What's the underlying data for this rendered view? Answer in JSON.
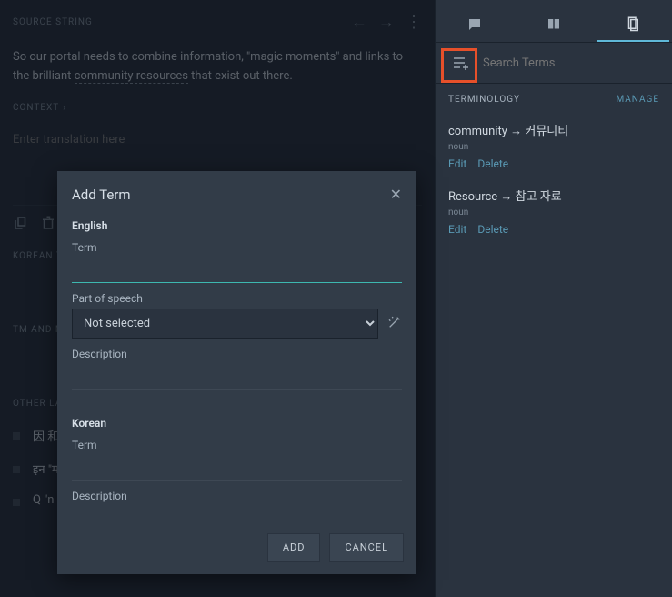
{
  "source": {
    "label": "SOURCE STRING",
    "text_before": "So our portal needs to combine information, \"magic moments\" and links to the brilliant ",
    "underlined": "community resources",
    "text_after": " that exist out there."
  },
  "context": {
    "label": "CONTEXT"
  },
  "translation": {
    "placeholder": "Enter translation here"
  },
  "sections": {
    "korean": "KOREAN T",
    "tm": "TM AND M",
    "other": "OTHER LA"
  },
  "other_items": [
    "因\n和",
    "इन\n\"म",
    "Q\n\"n\nc"
  ],
  "right": {
    "search_placeholder": "Search Terms",
    "terminology_label": "TERMINOLOGY",
    "manage_label": "MANAGE",
    "terms": [
      {
        "title": "community → 커뮤니티",
        "pos": "noun"
      },
      {
        "title": "Resource → 참고 자료",
        "pos": "noun"
      }
    ],
    "edit_label": "Edit",
    "delete_label": "Delete"
  },
  "modal": {
    "title": "Add Term",
    "english_label": "English",
    "term_label": "Term",
    "pos_label": "Part of speech",
    "pos_selected": "Not selected",
    "description_label": "Description",
    "korean_label": "Korean",
    "add_btn": "ADD",
    "cancel_btn": "CANCEL"
  }
}
